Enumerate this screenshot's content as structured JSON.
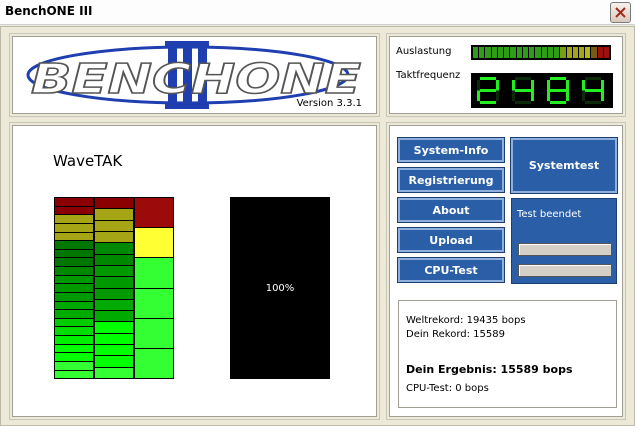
{
  "window": {
    "title": "BenchONE III"
  },
  "logo": {
    "text": "BENCHONE",
    "numeral": "III",
    "version": "Version 3.3.1"
  },
  "meters": {
    "load_label": "Auslastung",
    "freq_label": "Taktfrequenz",
    "freq_value": "2484",
    "load_segments": [
      "#2e9e16",
      "#2e9e16",
      "#2e9e16",
      "#2e9e16",
      "#2e9e16",
      "#2e9e16",
      "#2e9e16",
      "#2e9e16",
      "#2e9e16",
      "#2e9e16",
      "#2e9e16",
      "#2e9e16",
      "#2e9e16",
      "#2e9e16",
      "#7a9d18",
      "#a5a516",
      "#a5a516",
      "#a5a516",
      "#b8b814",
      "#7a5a10",
      "#9c1010",
      "#9c1010"
    ]
  },
  "benchmark": {
    "title": "WaveTAK",
    "progress": "100%",
    "col1_segments": [
      "#8b0000",
      "#8b0000",
      "#a5a516",
      "#a5a516",
      "#a5a516",
      "#007700",
      "#007700",
      "#007700",
      "#008800",
      "#009900",
      "#009900",
      "#009900",
      "#00aa00",
      "#00aa00",
      "#00cc00",
      "#00dd00",
      "#00ee00",
      "#00ff00",
      "#00ff00",
      "#33ff33",
      "#33ff33"
    ],
    "col2_segments": [
      "#8b0000",
      "#a5a516",
      "#a5a516",
      "#a5a516",
      "#008800",
      "#008800",
      "#009900",
      "#009900",
      "#009900",
      "#00aa00",
      "#00aa00",
      "#00ff00",
      "#00ff00",
      "#00ff00",
      "#00ff00",
      "#33ff33"
    ],
    "col3_segments": [
      "#9c0a0a",
      "#ffff33",
      "#33ff33",
      "#33ff33",
      "#33ff33",
      "#33ff33"
    ]
  },
  "controls": {
    "system_info": "System-Info",
    "registrierung": "Registrierung",
    "about": "About",
    "upload": "Upload",
    "cpu_test": "CPU-Test",
    "systemtest": "Systemtest",
    "status": "Test beendet"
  },
  "results": {
    "world_record": "Weltrekord: 19435 bops",
    "your_record": "Dein Rekord: 15589",
    "your_result": "Dein Ergebnis: 15589 bops",
    "cpu_test": "CPU-Test: 0 bops"
  },
  "colors": {
    "button": "#2a5fa8",
    "panel_bg": "#ece9d8",
    "logo_blue": "#1f3fb0"
  }
}
